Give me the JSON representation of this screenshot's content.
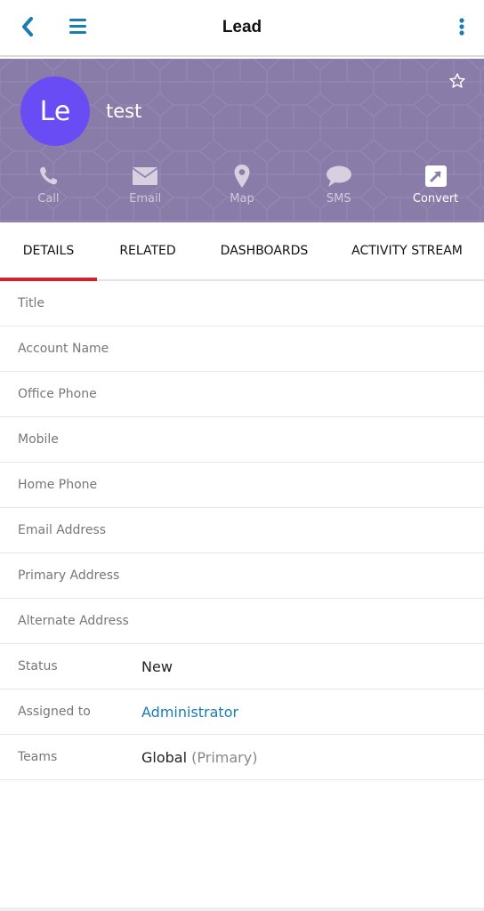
{
  "topbar": {
    "title": "Lead",
    "back_icon": "chevron-left-icon",
    "menu_icon": "hamburger-icon",
    "more_icon": "kebab-vertical-icon"
  },
  "header": {
    "avatar_initials": "Le",
    "record_name": "test",
    "favorite_icon": "star-outline-icon",
    "actions": [
      {
        "label": "Call",
        "icon": "phone-icon"
      },
      {
        "label": "Email",
        "icon": "envelope-icon"
      },
      {
        "label": "Map",
        "icon": "map-pin-icon"
      },
      {
        "label": "SMS",
        "icon": "speech-bubble-icon"
      },
      {
        "label": "Convert",
        "icon": "external-arrow-icon"
      }
    ]
  },
  "tabs": [
    {
      "label": "DETAILS",
      "active": true
    },
    {
      "label": "RELATED",
      "active": false
    },
    {
      "label": "DASHBOARDS",
      "active": false
    },
    {
      "label": "ACTIVITY STREAM",
      "active": false
    }
  ],
  "fields": [
    {
      "label": "Title",
      "value": ""
    },
    {
      "label": "Account Name",
      "value": ""
    },
    {
      "label": "Office Phone",
      "value": ""
    },
    {
      "label": "Mobile",
      "value": ""
    },
    {
      "label": "Home Phone",
      "value": ""
    },
    {
      "label": "Email Address",
      "value": ""
    },
    {
      "label": "Primary Address",
      "value": ""
    },
    {
      "label": "Alternate Address",
      "value": ""
    },
    {
      "label": "Status",
      "value": "New"
    },
    {
      "label": "Assigned to",
      "value": "Administrator"
    },
    {
      "label": "Teams",
      "value": "Global",
      "value_suffix": "(Primary)"
    }
  ],
  "colors": {
    "accent": "#1a7cb4",
    "header_bg": "#8a7ca8",
    "avatar_bg": "#6a4cf5",
    "active_tab_indicator": "#d0222e"
  }
}
